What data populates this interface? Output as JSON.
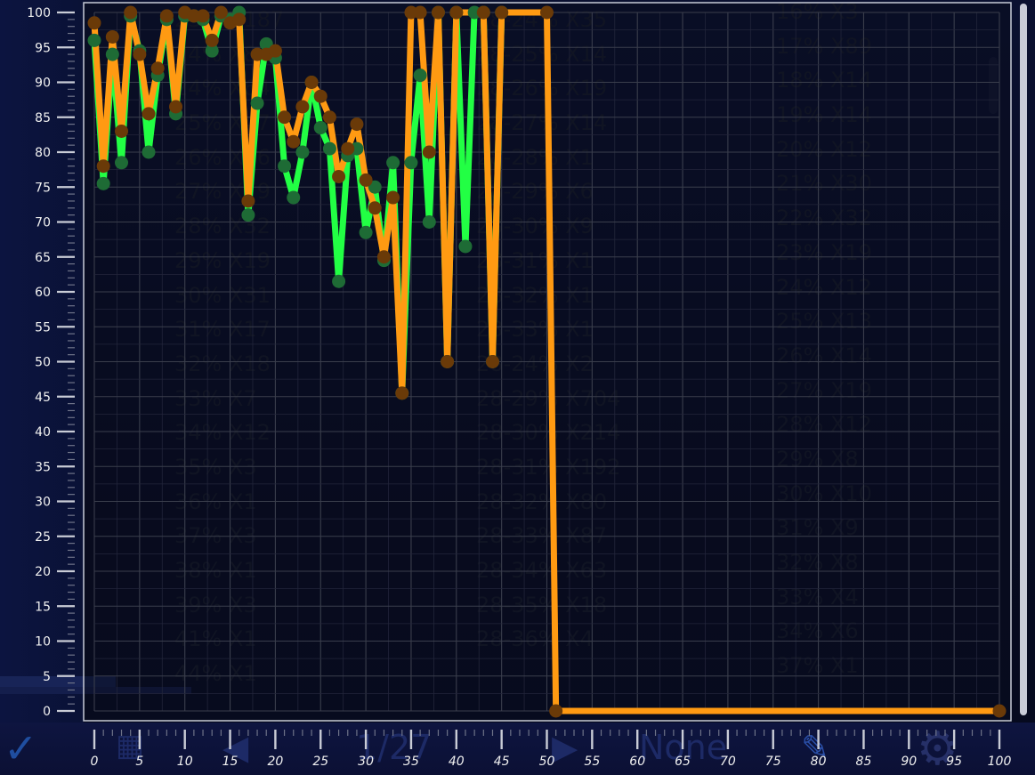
{
  "background_text": {
    "col1": [
      "23% X187",
      "24% X84",
      "24% X64",
      "25% X47",
      "26% X56",
      "27% X79",
      "28% X32",
      "29% X19",
      "30% X31",
      "31% X17",
      "32% X18",
      "33% X7",
      "34% X12",
      "35% X3",
      "36% X1",
      "37% X3",
      "38% X1",
      "39% X3",
      "41% X1",
      "44% X1"
    ],
    "col2": [
      "28-24% X35",
      "28-25% X14",
      "28-26% X19",
      "28-27% X14",
      "28-28% X1",
      "28-29% X6",
      "28-30% X9",
      "28-31% X1",
      "28-32% X1",
      "28-33% X1",
      "28-24% X2",
      "28-29% X704",
      "28-30% X214",
      "28-31% X192",
      "28-32% X80",
      "28-33% X87",
      "28-34% X63",
      "28-35% X18",
      "28-36% X4"
    ],
    "col3": [
      "16% X3",
      "17% X89",
      "18% X14",
      "19% X14",
      "20% X12",
      "21% X30",
      "22% X32",
      "23% X19",
      "24% X12",
      "25% X13",
      "26% X14",
      "27% X19",
      "28% X12",
      "29% X8",
      "30% X10",
      "31% X9",
      "32% X8",
      "33% X4",
      "34% X6",
      "37% X1"
    ]
  },
  "bottom_bar": {
    "check": "✓",
    "grid": "▦",
    "prev": "◀",
    "page": "1/27",
    "next": "▶",
    "none_label": "None",
    "pen": "✎",
    "gear": "⚙"
  },
  "chart_data": {
    "type": "line",
    "xlim": [
      0,
      100
    ],
    "ylim": [
      0,
      100
    ],
    "xticks": [
      0,
      5,
      10,
      15,
      20,
      25,
      30,
      35,
      40,
      45,
      50,
      55,
      60,
      65,
      70,
      75,
      80,
      85,
      90,
      95,
      100
    ],
    "yticks": [
      0,
      5,
      10,
      15,
      20,
      25,
      30,
      35,
      40,
      45,
      50,
      55,
      60,
      65,
      70,
      75,
      80,
      85,
      90,
      95,
      100
    ],
    "grid": true,
    "series": [
      {
        "color": "#22ff44",
        "marker_color": "#1e6b35",
        "x": [
          0,
          1,
          2,
          3,
          4,
          5,
          6,
          7,
          8,
          9,
          10,
          11,
          12,
          13,
          14,
          15,
          16,
          17,
          18,
          19,
          20,
          21,
          22,
          23,
          24,
          25,
          26,
          27,
          28,
          29,
          30,
          31,
          32,
          33,
          34,
          35,
          36,
          37,
          38,
          39,
          40,
          41,
          42,
          43,
          44,
          45
        ],
        "y": [
          96,
          75.5,
          94,
          78.5,
          99.5,
          94.5,
          80,
          91,
          99,
          85.5,
          99.5,
          99.5,
          99,
          94.5,
          99.5,
          99,
          100,
          71,
          87,
          95.5,
          93.5,
          78,
          73.5,
          80,
          90,
          83.5,
          80.5,
          61.5,
          79.5,
          80.5,
          68.5,
          75,
          64.5,
          78.5,
          45.5,
          78.5,
          91,
          70,
          100,
          50,
          100,
          66.5,
          100,
          100,
          50,
          100
        ]
      },
      {
        "color": "#ff9a12",
        "marker_color": "#6a3a08",
        "x": [
          0,
          1,
          2,
          3,
          4,
          5,
          6,
          7,
          8,
          9,
          10,
          11,
          12,
          13,
          14,
          15,
          16,
          17,
          18,
          19,
          20,
          21,
          22,
          23,
          24,
          25,
          26,
          27,
          28,
          29,
          30,
          31,
          32,
          33,
          34,
          35,
          36,
          37,
          38,
          39,
          40,
          41,
          42,
          43,
          44,
          45,
          46,
          47,
          48,
          49,
          50,
          51,
          100
        ],
        "y": [
          98.5,
          78,
          96.5,
          83,
          100,
          94,
          85.5,
          92,
          99.5,
          86.5,
          100,
          99.5,
          99.5,
          96,
          100,
          98.5,
          99,
          73,
          94,
          94,
          94.5,
          85,
          81.5,
          86.5,
          90,
          88,
          85,
          76.5,
          80.5,
          84,
          76,
          72,
          65,
          73.5,
          45.5,
          100,
          100,
          80,
          100,
          50,
          100,
          100,
          100,
          100,
          50,
          100,
          100,
          100,
          100,
          100,
          100,
          0,
          0
        ],
        "markers": [
          0,
          1,
          2,
          3,
          4,
          5,
          6,
          7,
          8,
          9,
          10,
          11,
          12,
          13,
          14,
          15,
          16,
          17,
          18,
          19,
          20,
          21,
          22,
          23,
          24,
          25,
          26,
          27,
          28,
          29,
          30,
          31,
          32,
          33,
          34,
          35,
          36,
          37,
          38,
          39,
          40,
          43,
          44,
          45,
          50,
          51,
          100
        ]
      }
    ]
  }
}
